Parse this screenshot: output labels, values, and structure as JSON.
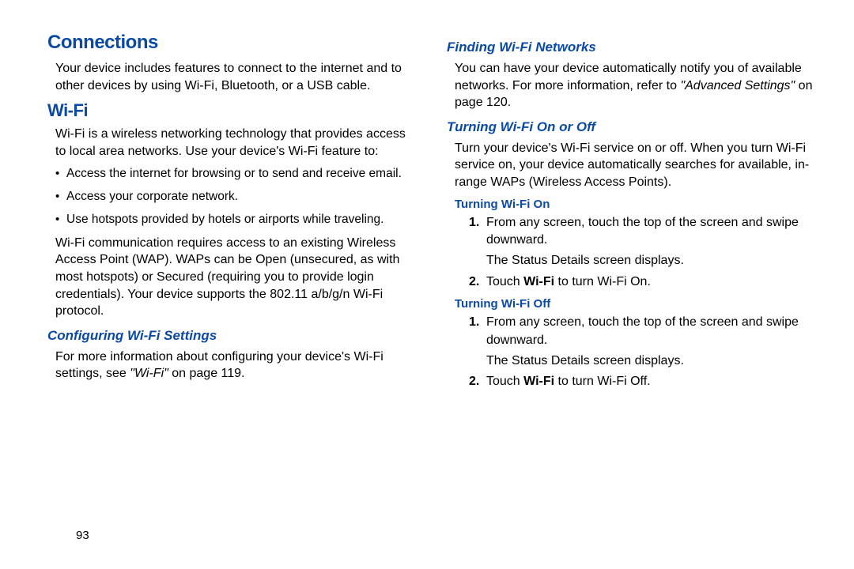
{
  "pageNumber": "93",
  "col1": {
    "h1": "Connections",
    "p1": "Your device includes features to connect to the internet and to other devices by using Wi-Fi, Bluetooth, or a USB cable.",
    "h2": "Wi-Fi",
    "p2": "Wi-Fi is a wireless networking technology that provides access to local area networks. Use your device's Wi-Fi feature to:",
    "bullets": [
      "Access the internet for browsing or to send and receive email.",
      "Access your corporate network.",
      "Use hotspots provided by hotels or airports while traveling."
    ],
    "p3": "Wi-Fi communication requires access to an existing Wireless Access Point (WAP). WAPs can be Open (unsecured, as with most hotspots) or Secured (requiring you to provide login credentials). Your device supports the 802.11 a/b/g/n Wi-Fi protocol.",
    "h3": "Configuring Wi-Fi Settings",
    "p4a": "For more information about configuring your device's Wi-Fi settings, see ",
    "p4b": "\"Wi-Fi\"",
    "p4c": " on page 119."
  },
  "col2": {
    "h3a": "Finding Wi-Fi Networks",
    "p1a": "You can have your device automatically notify you of available networks. For more information, refer to ",
    "p1b": "\"Advanced Settings\"",
    "p1c": " on page 120.",
    "h3b": "Turning Wi-Fi On or Off",
    "p2": "Turn your device's Wi-Fi service on or off. When you turn Wi-Fi service on, your device automatically searches for available, in-range WAPs (Wireless Access Points).",
    "h4a": "Turning Wi-Fi On",
    "on_step1": "From any screen, touch the top of the screen and swipe downward.",
    "on_step1_sub": "The Status Details screen displays.",
    "on_step2a": "Touch ",
    "on_step2b": "Wi-Fi",
    "on_step2c": " to turn Wi-Fi On.",
    "h4b": "Turning Wi-Fi Off",
    "off_step1": "From any screen, touch the top of the screen and swipe downward.",
    "off_step1_sub": "The Status Details screen displays.",
    "off_step2a": "Touch ",
    "off_step2b": "Wi-Fi",
    "off_step2c": " to turn Wi-Fi Off.",
    "num1": "1.",
    "num2": "2."
  }
}
